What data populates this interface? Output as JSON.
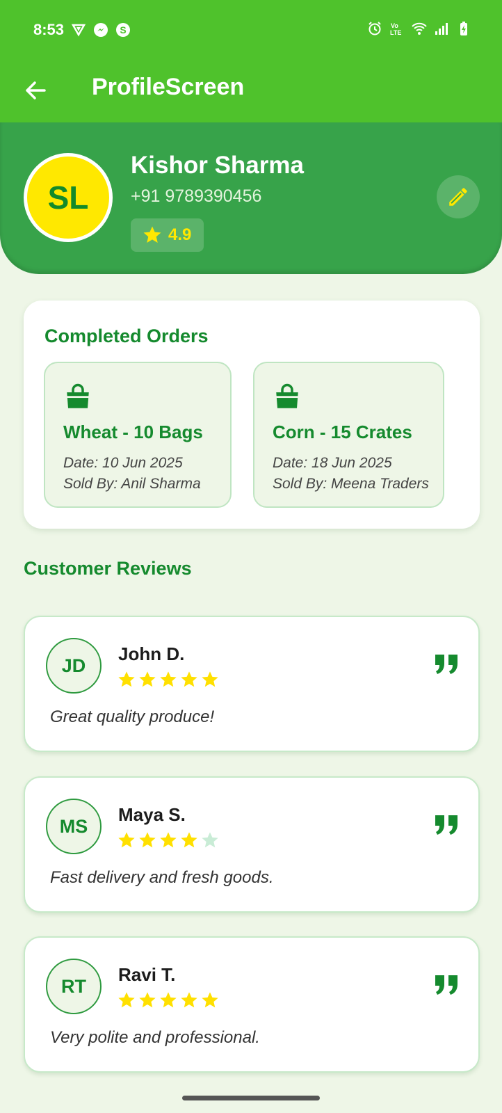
{
  "status_bar": {
    "time": "8:53",
    "icons_left": [
      "vpn-shield-icon",
      "messenger-icon",
      "skype-icon"
    ],
    "icons_right": [
      "alarm-icon",
      "volte-icon",
      "wifi-icon",
      "signal-icon",
      "battery-charging-icon"
    ]
  },
  "app_bar": {
    "title": "ProfileScreen",
    "back_icon": "arrow-left-icon"
  },
  "profile": {
    "initials": "SL",
    "name": "Kishor Sharma",
    "phone": "+91 9789390456",
    "rating": "4.9",
    "edit_icon": "pencil-icon",
    "colors": {
      "header": "#37a34a",
      "avatar": "#ffe800",
      "accent": "#158a2e"
    }
  },
  "completed_orders": {
    "title": "Completed Orders",
    "items": [
      {
        "title": "Wheat - 10 Bags",
        "date": "Date: 10 Jun 2025",
        "seller": "Sold By: Anil Sharma"
      },
      {
        "title": "Corn - 15 Crates",
        "date": "Date: 18 Jun 2025",
        "seller": "Sold By: Meena Traders"
      }
    ]
  },
  "reviews": {
    "title": "Customer Reviews",
    "items": [
      {
        "initials": "JD",
        "name": "John D.",
        "stars": 5,
        "text": "Great quality produce!"
      },
      {
        "initials": "MS",
        "name": "Maya S.",
        "stars": 4,
        "text": "Fast delivery and fresh goods."
      },
      {
        "initials": "RT",
        "name": "Ravi T.",
        "stars": 5,
        "text": "Very polite and professional."
      }
    ]
  }
}
